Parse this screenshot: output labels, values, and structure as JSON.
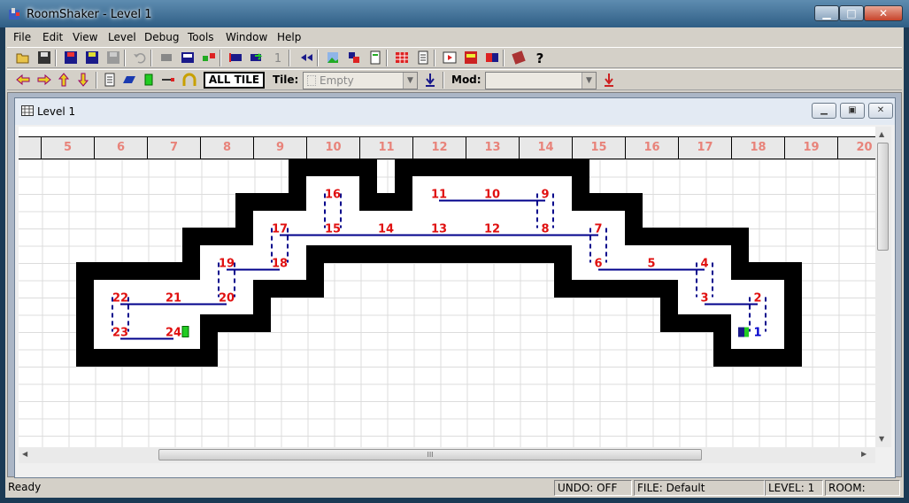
{
  "window": {
    "title": "RoomShaker - Level 1",
    "minimize": "▁",
    "maximize": "□",
    "close": "✕"
  },
  "menu": [
    "File",
    "Edit",
    "View",
    "Level",
    "Debug",
    "Tools",
    "Window",
    "Help"
  ],
  "toolbar2": {
    "alltile_label": "ALL TILE",
    "tile_label": "Tile:",
    "tile_value": "Empty",
    "mod_label": "Mod:",
    "mod_value": ""
  },
  "child_window": {
    "title": "Level 1"
  },
  "ruler_columns": [
    "5",
    "6",
    "7",
    "8",
    "9",
    "10",
    "11",
    "12",
    "13",
    "14",
    "15",
    "16",
    "17",
    "18",
    "19",
    "20"
  ],
  "rooms": [
    "1",
    "2",
    "3",
    "4",
    "5",
    "6",
    "7",
    "8",
    "9",
    "10",
    "11",
    "12",
    "13",
    "14",
    "15",
    "16",
    "17",
    "18",
    "19",
    "20",
    "21",
    "22",
    "23",
    "24"
  ],
  "status": {
    "ready": "Ready",
    "undo": "UNDO: OFF",
    "file": "FILE: Default",
    "level": "LEVEL: 1",
    "room": "ROOM:"
  },
  "colors": {
    "room_number": "#e01010",
    "link_line": "#00008b",
    "wall": "#000000",
    "ruler_text": "#e8837a",
    "start_number": "#0000cc"
  }
}
